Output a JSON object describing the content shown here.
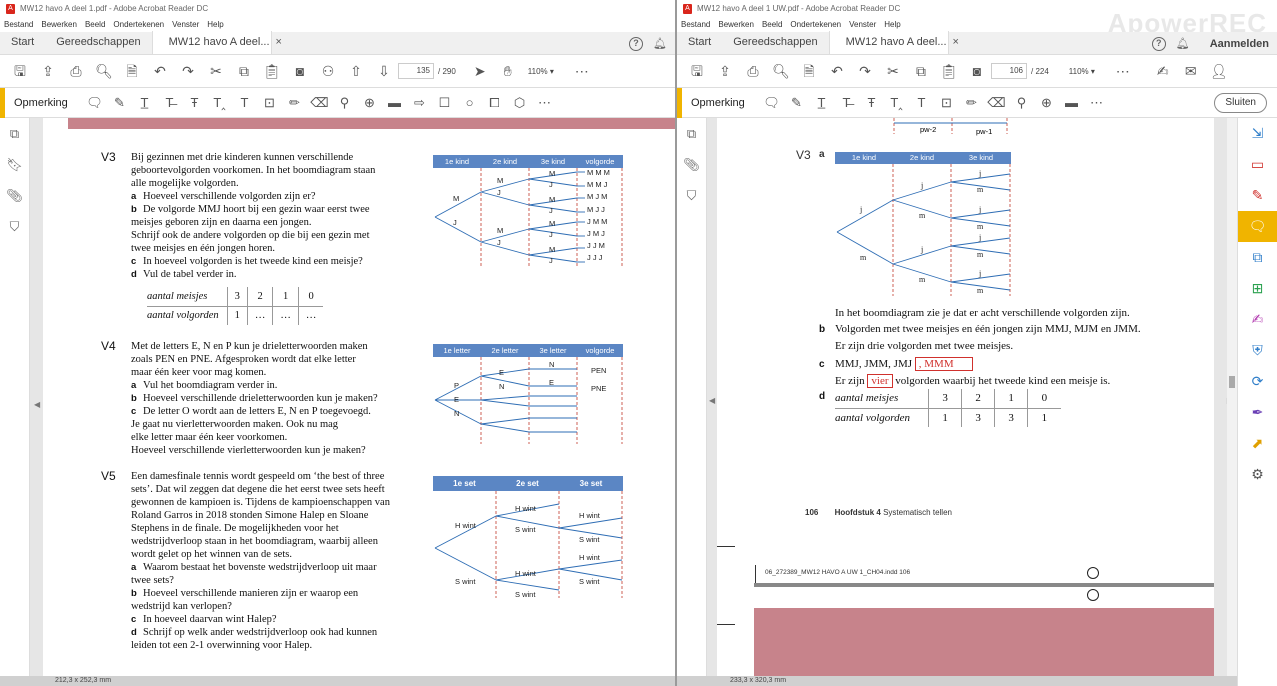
{
  "left": {
    "title": "MW12 havo A deel 1.pdf - Adobe Acrobat Reader DC",
    "menu": [
      "Bestand",
      "Bewerken",
      "Beeld",
      "Ondertekenen",
      "Venster",
      "Help"
    ],
    "tabs": {
      "start": "Start",
      "tools": "Gereedschappen",
      "doc": "MW12 havo A deel..."
    },
    "page_current": "135",
    "page_total": "/ 290",
    "zoom": "110%",
    "comment_label": "Opmerking",
    "status": "212,3 x 252,3 mm",
    "v3": {
      "num": "V3",
      "intro": [
        "Bij gezinnen met drie kinderen kunnen verschillende",
        "geboortevolgorden voorkomen. In het boomdiagram staan",
        "alle mogelijke volgorden."
      ],
      "a": "Hoeveel verschillende volgorden zijn er?",
      "b1": "De volgorde MMJ hoort bij een gezin waar eerst twee",
      "b2": "meisjes geboren zijn en daarna een jongen.",
      "b3": "Schrijf ook de andere volgorden op die bij een gezin met",
      "b4": "twee meisjes en één jongen horen.",
      "c": "In hoeveel volgorden is het tweede kind een meisje?",
      "d": "Vul de tabel verder in.",
      "table": {
        "r1": [
          "aantal meisjes",
          "3",
          "2",
          "1",
          "0"
        ],
        "r2": [
          "aantal volgorden",
          "1",
          "…",
          "…",
          "…"
        ]
      },
      "diag_headers": [
        "1e kind",
        "2e kind",
        "3e kind",
        "volgorde"
      ],
      "orders": [
        "M M M",
        "M M J",
        "M J M",
        "M J J",
        "J M M",
        "J M J",
        "J J M",
        "J J J"
      ],
      "labels": {
        "m1": "M",
        "j1": "J",
        "m2a": "M",
        "j2a": "J",
        "m2b": "M",
        "j2b": "J",
        "m3a": "M",
        "j3a": "J",
        "m3b": "M",
        "j3b": "J",
        "m3c": "M",
        "j3c": "J",
        "m3d": "M",
        "j3d": "J"
      }
    },
    "v4": {
      "num": "V4",
      "intro": [
        "Met de letters E, N en P kun je drieletterwoorden maken",
        "zoals PEN en PNE. Afgesproken wordt dat elke letter",
        "maar één keer voor mag komen."
      ],
      "a": "Vul het boomdiagram verder in.",
      "b": "Hoeveel verschillende drieletterwoorden kun je maken?",
      "c1": "De letter O wordt aan de letters E, N en P toegevoegd.",
      "c2": "Je gaat nu vierletterwoorden maken. Ook nu mag",
      "c3": "elke letter maar één keer voorkomen.",
      "c4": "Hoeveel verschillende vierletterwoorden kun je maken?",
      "diag_headers": [
        "1e letter",
        "2e letter",
        "3e letter",
        "volgorde"
      ],
      "labels": {
        "p": "P",
        "e": "E",
        "n": "N",
        "e2": "E",
        "n2": "N",
        "n3": "N",
        "e3": "E",
        "pen": "PEN",
        "pne": "PNE"
      }
    },
    "v5": {
      "num": "V5",
      "intro": [
        "Een damesfinale tennis wordt gespeeld om ‘the best of three",
        "sets’. Dat wil zeggen dat degene die het eerst twee sets heeft",
        "gewonnen de kampioen is. Tijdens de kampioenschappen van",
        "Roland Garros in 2018 stonden Simone Halep en Sloane",
        "Stephens in de finale. De mogelijkheden voor het",
        "wedstrijdverloop staan in het boomdiagram, waarbij alleen",
        "wordt gelet op het winnen van de sets."
      ],
      "a1": "Waarom bestaat het bovenste wedstrijdverloop uit maar",
      "a2": "twee sets?",
      "b1": "Hoeveel verschillende manieren zijn er waarop een",
      "b2": "wedstrijd kan verlopen?",
      "c": "In hoeveel daarvan wint Halep?",
      "d1": "Schrijf op welk ander wedstrijdverloop ook had kunnen",
      "d2": "leiden tot een 2-1 overwinning voor Halep.",
      "diag_headers": [
        "1e set",
        "2e set",
        "3e set"
      ],
      "labels": {
        "hw1": "H wint",
        "sw1": "S wint",
        "hw2a": "H wint",
        "sw2a": "S wint",
        "hw2b": "H wint",
        "sw2b": "S wint",
        "hw3a": "H wint",
        "sw3a": "S wint",
        "hw3b": "H wint",
        "sw3b": "S wint"
      }
    },
    "letters": {
      "a": "a",
      "b": "b",
      "c": "c",
      "d": "d"
    }
  },
  "right": {
    "title": "MW12 havo A deel 1 UW.pdf - Adobe Acrobat Reader DC",
    "menu": [
      "Bestand",
      "Bewerken",
      "Beeld",
      "Ondertekenen",
      "Venster",
      "Help"
    ],
    "tabs": {
      "start": "Start",
      "tools": "Gereedschappen",
      "doc": "MW12 havo A deel...",
      "login": "Aanmelden"
    },
    "page_current": "106",
    "page_total": "/ 224",
    "zoom": "110%",
    "comment_label": "Opmerking",
    "close": "Sluiten",
    "watermark": "ApowerREC",
    "status": "233,3 x 320,3 mm",
    "pw": [
      "pw-2",
      "pw-1"
    ],
    "v3": {
      "num": "V3",
      "a": "a",
      "diag_headers": [
        "1e kind",
        "2e kind",
        "3e kind"
      ],
      "tree": [
        "j",
        "m",
        "j",
        "m",
        "j",
        "m",
        "j",
        "m",
        "j",
        "m",
        "j",
        "m",
        "j",
        "m"
      ],
      "line1": "In het boomdiagram zie je dat er acht verschillende volgorden zijn.",
      "b": "b",
      "line2": "Volgorden met twee meisjes en één jongen zijn MMJ, MJM en JMM.",
      "line3": "Er zijn drie volgorden met twee meisjes.",
      "c": "c",
      "line4": "MMJ, JMM, JMJ",
      "box1": ", MMM",
      "line5a": "Er zijn",
      "box2": "vier",
      "line5b": "volgorden waarbij het tweede kind een meisje is.",
      "d": "d",
      "table": {
        "r1": [
          "aantal meisjes",
          "3",
          "2",
          "1",
          "0"
        ],
        "r2": [
          "aantal volgorden",
          "1",
          "3",
          "3",
          "1"
        ]
      }
    },
    "footer": {
      "page": "106",
      "chapter": "Hoofdstuk 4",
      "chapter_title": "Systematisch tellen"
    },
    "slug": "06_272389_MW12 HAVO A UW 1_CH04.indd   106"
  }
}
